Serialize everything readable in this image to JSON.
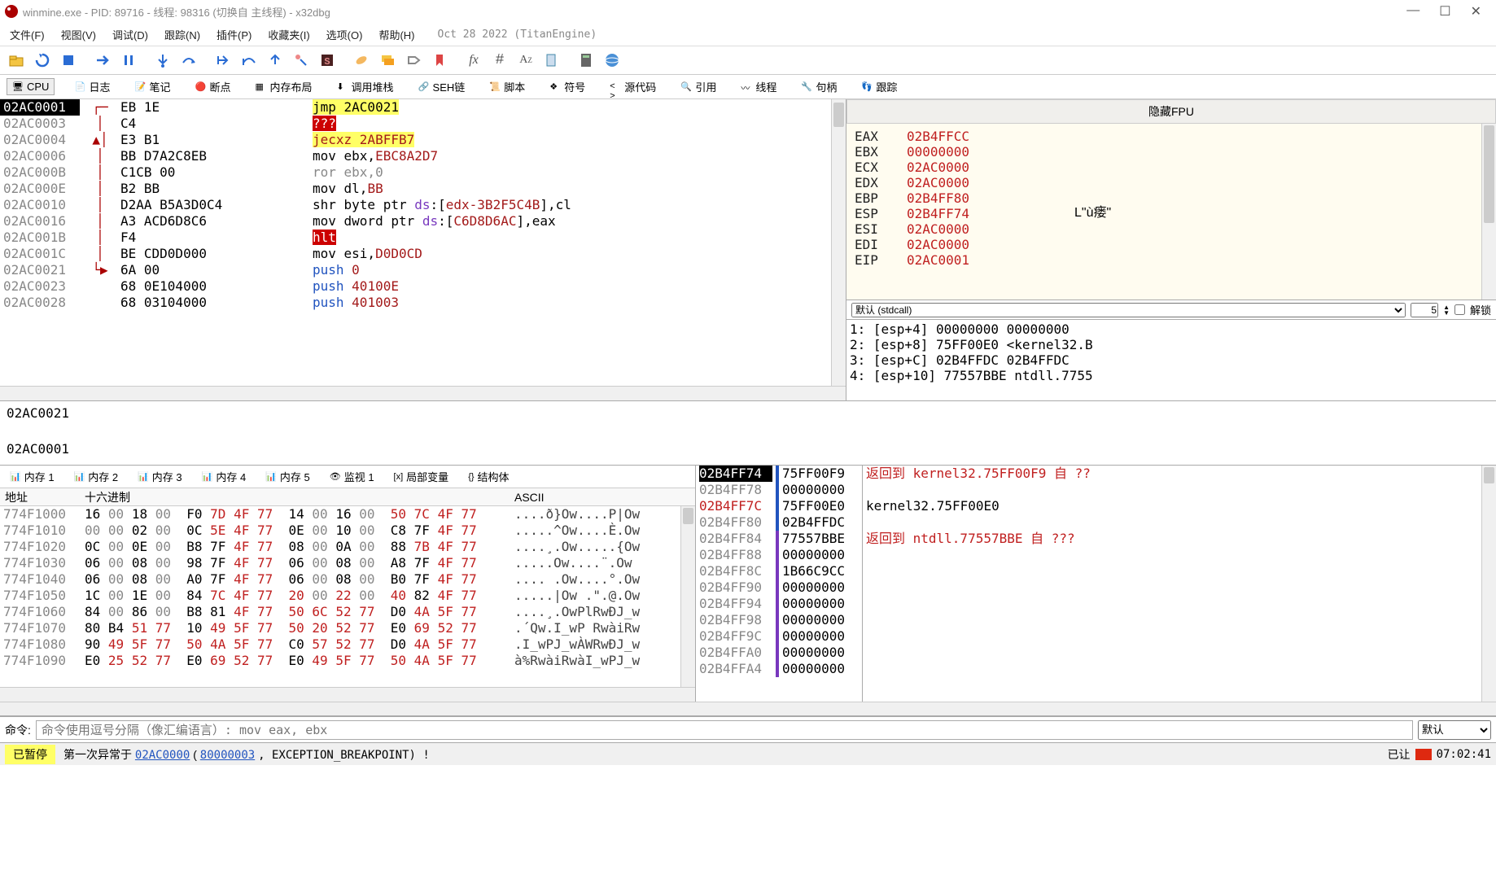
{
  "title": "winmine.exe - PID: 89716 - 线程: 98316 (切换自 主线程) - x32dbg",
  "menu": [
    "文件(F)",
    "视图(V)",
    "调试(D)",
    "跟踪(N)",
    "插件(P)",
    "收藏夹(I)",
    "选项(O)",
    "帮助(H)"
  ],
  "menu_date": "Oct 28 2022 (TitanEngine)",
  "tabs": [
    {
      "icon": "cpu",
      "label": "CPU",
      "active": true
    },
    {
      "icon": "log",
      "label": "日志"
    },
    {
      "icon": "notes",
      "label": "笔记"
    },
    {
      "icon": "bp",
      "label": "断点"
    },
    {
      "icon": "mem",
      "label": "内存布局"
    },
    {
      "icon": "call",
      "label": "调用堆栈"
    },
    {
      "icon": "seh",
      "label": "SEH链"
    },
    {
      "icon": "script",
      "label": "脚本"
    },
    {
      "icon": "sym",
      "label": "符号"
    },
    {
      "icon": "src",
      "label": "源代码"
    },
    {
      "icon": "ref",
      "label": "引用"
    },
    {
      "icon": "thr",
      "label": "线程"
    },
    {
      "icon": "hnd",
      "label": "句柄"
    },
    {
      "icon": "trc",
      "label": "跟踪"
    }
  ],
  "disasm": [
    {
      "addr": "02AC0001",
      "hl": true,
      "mark": "┌─",
      "bytes": "EB 1E",
      "mnem": [
        {
          "t": "jmp ",
          "c": "hl-yellow"
        },
        {
          "t": "2AC0021",
          "c": "hl-yellow"
        }
      ]
    },
    {
      "addr": "02AC0003",
      "mark": "│",
      "bytes": "C4",
      "mnem": [
        {
          "t": "???",
          "c": "hl-red"
        }
      ]
    },
    {
      "addr": "02AC0004",
      "mark": "▲│",
      "bytes": "E3 B1",
      "mnem": [
        {
          "t": "jecxz ",
          "c": "hl-yellow c-darkred"
        },
        {
          "t": "2ABFFB7",
          "c": "hl-yellow c-darkred"
        }
      ]
    },
    {
      "addr": "02AC0006",
      "mark": "│",
      "bytes": "BB D7A2C8EB",
      "mnem": [
        {
          "t": "mov ebx,"
        },
        {
          "t": "EBC8A2D7",
          "c": "c-darkred"
        }
      ]
    },
    {
      "addr": "02AC000B",
      "mark": "│",
      "bytes": "C1CB 00",
      "mnem": [
        {
          "t": "ror ebx,0",
          "c": "c-gray"
        }
      ]
    },
    {
      "addr": "02AC000E",
      "mark": "│",
      "bytes": "B2 BB",
      "mnem": [
        {
          "t": "mov dl,"
        },
        {
          "t": "BB",
          "c": "c-darkred"
        }
      ]
    },
    {
      "addr": "02AC0010",
      "mark": "│",
      "bytes": "D2AA B5A3D0C4",
      "mnem": [
        {
          "t": "shr byte ptr "
        },
        {
          "t": "ds",
          "c": "c-purple"
        },
        {
          "t": ":["
        },
        {
          "t": "edx-3B2F5C4B",
          "c": "c-darkred"
        },
        {
          "t": "],cl"
        }
      ]
    },
    {
      "addr": "02AC0016",
      "mark": "│",
      "bytes": "A3 ACD6D8C6",
      "mnem": [
        {
          "t": "mov dword ptr "
        },
        {
          "t": "ds",
          "c": "c-purple"
        },
        {
          "t": ":["
        },
        {
          "t": "C6D8D6AC",
          "c": "c-darkred"
        },
        {
          "t": "],eax"
        }
      ]
    },
    {
      "addr": "02AC001B",
      "mark": "│",
      "bytes": "F4",
      "mnem": [
        {
          "t": "hlt",
          "c": "hl-red"
        }
      ]
    },
    {
      "addr": "02AC001C",
      "mark": "│",
      "bytes": "BE CDD0D000",
      "mnem": [
        {
          "t": "mov esi,"
        },
        {
          "t": "D0D0CD",
          "c": "c-darkred"
        }
      ]
    },
    {
      "addr": "02AC0021",
      "mark": "└▶",
      "bytes": "6A 00",
      "mnem": [
        {
          "t": "push ",
          "c": "c-blue"
        },
        {
          "t": "0",
          "c": "c-darkred"
        }
      ]
    },
    {
      "addr": "02AC0023",
      "mark": "",
      "bytes": "68 0E104000",
      "mnem": [
        {
          "t": "push ",
          "c": "c-blue"
        },
        {
          "t": "40100E",
          "c": "c-darkred"
        }
      ]
    },
    {
      "addr": "02AC0028",
      "mark": "",
      "bytes": "68 03104000",
      "mnem": [
        {
          "t": "push ",
          "c": "c-blue"
        },
        {
          "t": "401003",
          "c": "c-darkred"
        }
      ]
    }
  ],
  "sub_info": [
    "02AC0021",
    "",
    "02AC0001"
  ],
  "regs_header": "隐藏FPU",
  "regs": [
    {
      "n": "EAX",
      "v": "02B4FFCC"
    },
    {
      "n": "EBX",
      "v": "00000000"
    },
    {
      "n": "ECX",
      "v": "02AC0000"
    },
    {
      "n": "EDX",
      "v": "02AC0000"
    },
    {
      "n": "EBP",
      "v": "02B4FF80"
    },
    {
      "n": "ESP",
      "v": "02B4FF74"
    },
    {
      "n": "ESI",
      "v": "02AC0000"
    },
    {
      "n": "EDI",
      "v": "02AC0000"
    },
    {
      "n": "",
      "v": ""
    },
    {
      "n": "EIP",
      "v": "02AC0001"
    }
  ],
  "reg_hint": "L\"ù瘘\"",
  "stack_args_ctrl": {
    "conv": "默认 (stdcall)",
    "count": "5",
    "lock": "解锁"
  },
  "stack_args": [
    "1: [esp+4] 00000000 00000000",
    "2: [esp+8] 75FF00E0 <kernel32.B",
    "3: [esp+C] 02B4FFDC 02B4FFDC",
    "4: [esp+10] 77557BBE ntdll.7755"
  ],
  "dump_tabs": [
    "内存 1",
    "内存 2",
    "内存 3",
    "内存 4",
    "内存 5",
    "监视 1",
    "局部变量",
    "结构体"
  ],
  "dump_header": {
    "addr": "地址",
    "hex": "十六进制",
    "ascii": "ASCII"
  },
  "dump_rows": [
    {
      "a": "774F1000",
      "h": "16 00 18 00  F0 7D 4F 77  14 00 16 00  50 7C 4F 77",
      "as": "....ð}Ow....P|Ow"
    },
    {
      "a": "774F1010",
      "h": "00 00 02 00  0C 5E 4F 77  0E 00 10 00  C8 7F 4F 77",
      "as": ".....^Ow....È.Ow"
    },
    {
      "a": "774F1020",
      "h": "0C 00 0E 00  B8 7F 4F 77  08 00 0A 00  88 7B 4F 77",
      "as": "....¸.Ow.....{Ow"
    },
    {
      "a": "774F1030",
      "h": "06 00 08 00  98 7F 4F 77  06 00 08 00  A8 7F 4F 77",
      "as": ".....Ow....¨.Ow"
    },
    {
      "a": "774F1040",
      "h": "06 00 08 00  A0 7F 4F 77  06 00 08 00  B0 7F 4F 77",
      "as": ".... .Ow....°.Ow"
    },
    {
      "a": "774F1050",
      "h": "1C 00 1E 00  84 7C 4F 77  20 00 22 00  40 82 4F 77",
      "as": ".....|Ow .\".@.Ow"
    },
    {
      "a": "774F1060",
      "h": "84 00 86 00  B8 81 4F 77  50 6C 52 77  D0 4A 5F 77",
      "as": "....¸.OwPlRwÐJ_w"
    },
    {
      "a": "774F1070",
      "h": "80 B4 51 77  10 49 5F 77  50 20 52 77  E0 69 52 77",
      "as": ".´Qw.I_wP RwàiRw"
    },
    {
      "a": "774F1080",
      "h": "90 49 5F 77  50 4A 5F 77  C0 57 52 77  D0 4A 5F 77",
      "as": ".I_wPJ_wÀWRwÐJ_w"
    },
    {
      "a": "774F1090",
      "h": "E0 25 52 77  E0 69 52 77  E0 49 5F 77  50 4A 5F 77",
      "as": "à%RwàiRwàI_wPJ_w"
    }
  ],
  "stack_col": [
    {
      "a": "02B4FF74",
      "hl": true,
      "v": "75FF00F9",
      "bar": "b"
    },
    {
      "a": "02B4FF78",
      "v": "00000000",
      "bar": "b"
    },
    {
      "a": "02B4FF7C",
      "v": "75FF00E0",
      "bar": "b",
      "addr_red": true
    },
    {
      "a": "02B4FF80",
      "v": "02B4FFDC",
      "bar": "b"
    },
    {
      "a": "02B4FF84",
      "v": "77557BBE",
      "bar": "p"
    },
    {
      "a": "02B4FF88",
      "v": "00000000",
      "bar": "p"
    },
    {
      "a": "02B4FF8C",
      "v": "1B66C9CC",
      "bar": "p"
    },
    {
      "a": "02B4FF90",
      "v": "00000000",
      "bar": "p"
    },
    {
      "a": "02B4FF94",
      "v": "00000000",
      "bar": "p"
    },
    {
      "a": "02B4FF98",
      "v": "00000000",
      "bar": "p"
    },
    {
      "a": "02B4FF9C",
      "v": "00000000",
      "bar": "p"
    },
    {
      "a": "02B4FFA0",
      "v": "00000000",
      "bar": "p"
    },
    {
      "a": "02B4FFA4",
      "v": "00000000",
      "bar": "p"
    }
  ],
  "callinfo": [
    {
      "t": "返回到 kernel32.75FF00F9 自 ??",
      "red": true
    },
    {
      "t": ""
    },
    {
      "t": "kernel32.75FF00E0"
    },
    {
      "t": ""
    },
    {
      "t": "返回到 ntdll.77557BBE 自 ???",
      "red": true
    }
  ],
  "cmd": {
    "label": "命令:",
    "placeholder": "命令使用逗号分隔（像汇编语言）: mov eax, ebx",
    "combo": "默认"
  },
  "status": {
    "paused": "已暂停",
    "msg_pre": "第一次异常于 ",
    "link1": "02AC0000",
    "mid": " (",
    "link2": "80000003",
    "post": ", EXCEPTION_BREAKPOINT) !",
    "right_label": "已让",
    "time": "07:02:41"
  }
}
